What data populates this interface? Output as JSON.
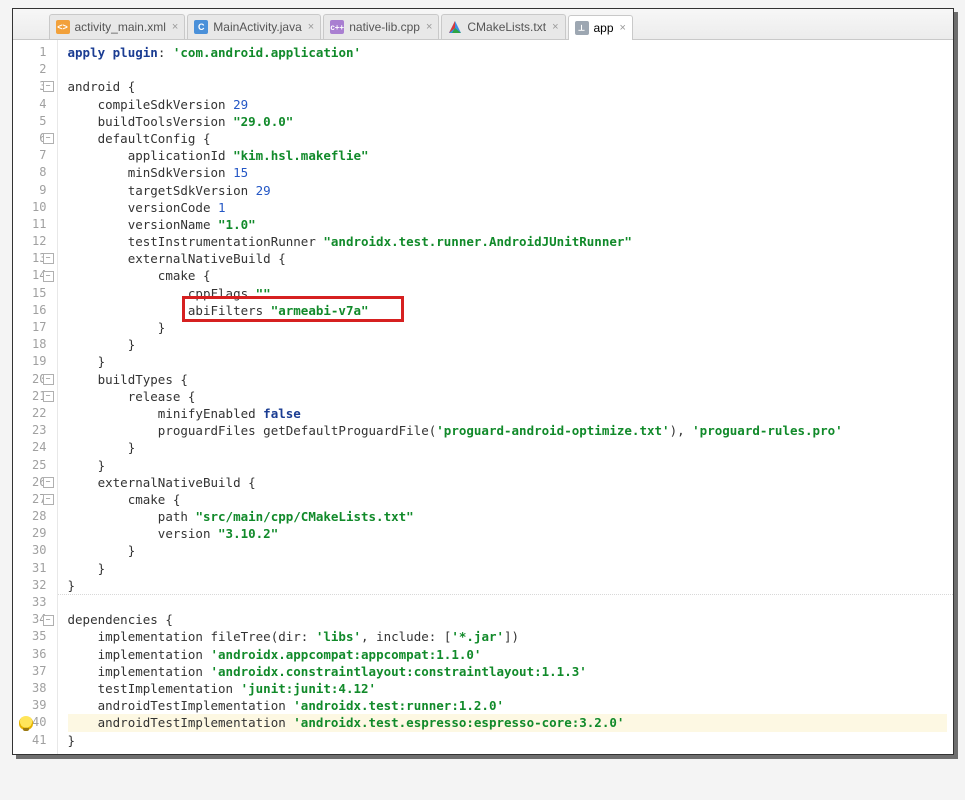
{
  "tabs": [
    {
      "label": "activity_main.xml",
      "icon": "xml",
      "icon_text": "<>",
      "active": false
    },
    {
      "label": "MainActivity.java",
      "icon": "java",
      "icon_text": "C",
      "active": false
    },
    {
      "label": "native-lib.cpp",
      "icon": "cpp",
      "icon_text": "c++",
      "active": false
    },
    {
      "label": "CMakeLists.txt",
      "icon": "cmake",
      "icon_text": "▲",
      "active": false
    },
    {
      "label": "app",
      "icon": "gradle",
      "icon_text": "⟂",
      "active": true
    }
  ],
  "file": {
    "name": "app",
    "type": "gradle"
  },
  "highlighted_line": 16,
  "highlighted_text": "abiFilters \"armeabi-v7a\"",
  "warning_line": 40,
  "code_lines": [
    {
      "n": 1,
      "tokens": [
        {
          "t": "apply ",
          "c": "kw"
        },
        {
          "t": "plugin",
          "c": "kw"
        },
        {
          "t": ": ",
          "c": "pl"
        },
        {
          "t": "'com.android.application'",
          "c": "str"
        }
      ]
    },
    {
      "n": 2,
      "tokens": []
    },
    {
      "n": 3,
      "tokens": [
        {
          "t": "android {",
          "c": "pl"
        }
      ],
      "fold": true
    },
    {
      "n": 4,
      "tokens": [
        {
          "t": "    compileSdkVersion ",
          "c": "pl"
        },
        {
          "t": "29",
          "c": "num"
        }
      ]
    },
    {
      "n": 5,
      "tokens": [
        {
          "t": "    buildToolsVersion ",
          "c": "pl"
        },
        {
          "t": "\"29.0.0\"",
          "c": "str"
        }
      ]
    },
    {
      "n": 6,
      "tokens": [
        {
          "t": "    defaultConfig {",
          "c": "pl"
        }
      ],
      "fold": true
    },
    {
      "n": 7,
      "tokens": [
        {
          "t": "        applicationId ",
          "c": "pl"
        },
        {
          "t": "\"kim.hsl.makeflie\"",
          "c": "str"
        }
      ]
    },
    {
      "n": 8,
      "tokens": [
        {
          "t": "        minSdkVersion ",
          "c": "pl"
        },
        {
          "t": "15",
          "c": "num"
        }
      ]
    },
    {
      "n": 9,
      "tokens": [
        {
          "t": "        targetSdkVersion ",
          "c": "pl"
        },
        {
          "t": "29",
          "c": "num"
        }
      ]
    },
    {
      "n": 10,
      "tokens": [
        {
          "t": "        versionCode ",
          "c": "pl"
        },
        {
          "t": "1",
          "c": "num"
        }
      ]
    },
    {
      "n": 11,
      "tokens": [
        {
          "t": "        versionName ",
          "c": "pl"
        },
        {
          "t": "\"1.0\"",
          "c": "str"
        }
      ]
    },
    {
      "n": 12,
      "tokens": [
        {
          "t": "        testInstrumentationRunner ",
          "c": "pl"
        },
        {
          "t": "\"androidx.test.runner.AndroidJUnitRunner\"",
          "c": "str"
        }
      ]
    },
    {
      "n": 13,
      "tokens": [
        {
          "t": "        externalNativeBuild {",
          "c": "pl"
        }
      ],
      "fold": true
    },
    {
      "n": 14,
      "tokens": [
        {
          "t": "            cmake {",
          "c": "pl"
        }
      ],
      "fold": true
    },
    {
      "n": 15,
      "tokens": [
        {
          "t": "                cppFlags ",
          "c": "pl"
        },
        {
          "t": "\"\"",
          "c": "str"
        }
      ]
    },
    {
      "n": 16,
      "tokens": [
        {
          "t": "                abiFilters ",
          "c": "pl"
        },
        {
          "t": "\"armeabi-v7a\"",
          "c": "str"
        }
      ]
    },
    {
      "n": 17,
      "tokens": [
        {
          "t": "            }",
          "c": "pl"
        }
      ]
    },
    {
      "n": 18,
      "tokens": [
        {
          "t": "        }",
          "c": "pl"
        }
      ]
    },
    {
      "n": 19,
      "tokens": [
        {
          "t": "    }",
          "c": "pl"
        }
      ]
    },
    {
      "n": 20,
      "tokens": [
        {
          "t": "    buildTypes {",
          "c": "pl"
        }
      ],
      "fold": true
    },
    {
      "n": 21,
      "tokens": [
        {
          "t": "        release {",
          "c": "pl"
        }
      ],
      "fold": true
    },
    {
      "n": 22,
      "tokens": [
        {
          "t": "            minifyEnabled ",
          "c": "pl"
        },
        {
          "t": "false",
          "c": "bool"
        }
      ]
    },
    {
      "n": 23,
      "tokens": [
        {
          "t": "            proguardFiles getDefaultProguardFile(",
          "c": "pl"
        },
        {
          "t": "'proguard-android-optimize.txt'",
          "c": "str"
        },
        {
          "t": "), ",
          "c": "pl"
        },
        {
          "t": "'proguard-rules.pro'",
          "c": "str"
        }
      ]
    },
    {
      "n": 24,
      "tokens": [
        {
          "t": "        }",
          "c": "pl"
        }
      ]
    },
    {
      "n": 25,
      "tokens": [
        {
          "t": "    }",
          "c": "pl"
        }
      ]
    },
    {
      "n": 26,
      "tokens": [
        {
          "t": "    externalNativeBuild {",
          "c": "pl"
        }
      ],
      "fold": true
    },
    {
      "n": 27,
      "tokens": [
        {
          "t": "        cmake {",
          "c": "pl"
        }
      ],
      "fold": true
    },
    {
      "n": 28,
      "tokens": [
        {
          "t": "            path ",
          "c": "pl"
        },
        {
          "t": "\"src/main/cpp/CMakeLists.txt\"",
          "c": "str"
        }
      ]
    },
    {
      "n": 29,
      "tokens": [
        {
          "t": "            version ",
          "c": "pl"
        },
        {
          "t": "\"3.10.2\"",
          "c": "str"
        }
      ]
    },
    {
      "n": 30,
      "tokens": [
        {
          "t": "        }",
          "c": "pl"
        }
      ]
    },
    {
      "n": 31,
      "tokens": [
        {
          "t": "    }",
          "c": "pl"
        }
      ]
    },
    {
      "n": 32,
      "tokens": [
        {
          "t": "}",
          "c": "pl"
        }
      ],
      "sep": true
    },
    {
      "n": 33,
      "tokens": []
    },
    {
      "n": 34,
      "tokens": [
        {
          "t": "dependencies {",
          "c": "pl"
        }
      ],
      "fold": true
    },
    {
      "n": 35,
      "tokens": [
        {
          "t": "    implementation fileTree(",
          "c": "pl"
        },
        {
          "t": "dir",
          "c": "id"
        },
        {
          "t": ": ",
          "c": "pl"
        },
        {
          "t": "'libs'",
          "c": "str"
        },
        {
          "t": ", ",
          "c": "pl"
        },
        {
          "t": "include",
          "c": "id"
        },
        {
          "t": ": [",
          "c": "pl"
        },
        {
          "t": "'*.jar'",
          "c": "str"
        },
        {
          "t": "])",
          "c": "pl"
        }
      ]
    },
    {
      "n": 36,
      "tokens": [
        {
          "t": "    implementation ",
          "c": "pl"
        },
        {
          "t": "'androidx.appcompat:appcompat:1.1.0'",
          "c": "str"
        }
      ]
    },
    {
      "n": 37,
      "tokens": [
        {
          "t": "    implementation ",
          "c": "pl"
        },
        {
          "t": "'androidx.constraintlayout:constraintlayout:1.1.3'",
          "c": "str"
        }
      ]
    },
    {
      "n": 38,
      "tokens": [
        {
          "t": "    testImplementation ",
          "c": "pl"
        },
        {
          "t": "'junit:junit:4.12'",
          "c": "str"
        }
      ]
    },
    {
      "n": 39,
      "tokens": [
        {
          "t": "    androidTestImplementation ",
          "c": "pl"
        },
        {
          "t": "'androidx.test:runner:1.2.0'",
          "c": "str"
        }
      ]
    },
    {
      "n": 40,
      "tokens": [
        {
          "t": "    androidTestImplementation ",
          "c": "pl"
        },
        {
          "t": "'androidx.test.espresso:espresso-core:3.2.0'",
          "c": "str"
        }
      ]
    },
    {
      "n": 41,
      "tokens": [
        {
          "t": "}",
          "c": "pl"
        }
      ]
    }
  ]
}
